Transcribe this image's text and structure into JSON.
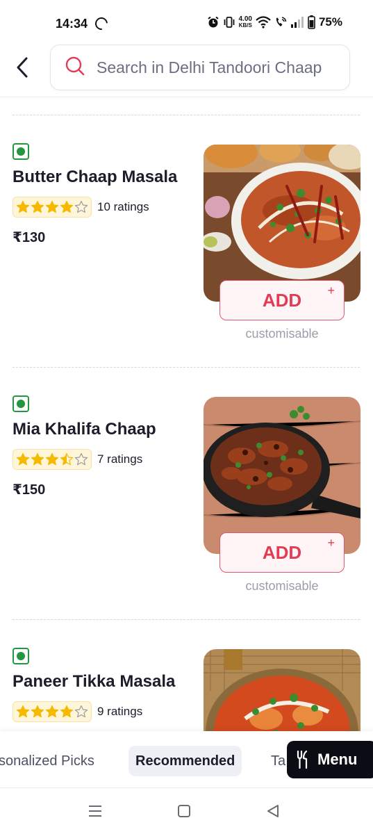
{
  "status_bar": {
    "time": "14:34",
    "net_speed": "4.00",
    "net_unit": "KB/S",
    "battery": "75%"
  },
  "header": {
    "search_placeholder": "Search in Delhi Tandoori Chaap"
  },
  "items": [
    {
      "name": "Butter Chaap Masala",
      "rating": 4.0,
      "rating_text": "10 ratings",
      "price": "₹130",
      "add_label": "ADD",
      "add_plus": "+",
      "customisable": "customisable",
      "veg": true
    },
    {
      "name": "Mia Khalifa Chaap",
      "rating": 3.5,
      "rating_text": "7 ratings",
      "price": "₹150",
      "add_label": "ADD",
      "add_plus": "+",
      "customisable": "customisable",
      "veg": true
    },
    {
      "name": "Paneer Tikka Masala",
      "rating": 4.0,
      "rating_text": "9 ratings",
      "price": "",
      "veg": true
    }
  ],
  "tabs": {
    "personalized": "sonalized Picks",
    "recommended": "Recommended",
    "next": "Ta"
  },
  "menu_button": {
    "label": "Menu"
  },
  "colors": {
    "accent": "#e23b53",
    "veg_green": "#24963f",
    "star_yellow": "#f5b900",
    "dark": "#0c0c14"
  }
}
